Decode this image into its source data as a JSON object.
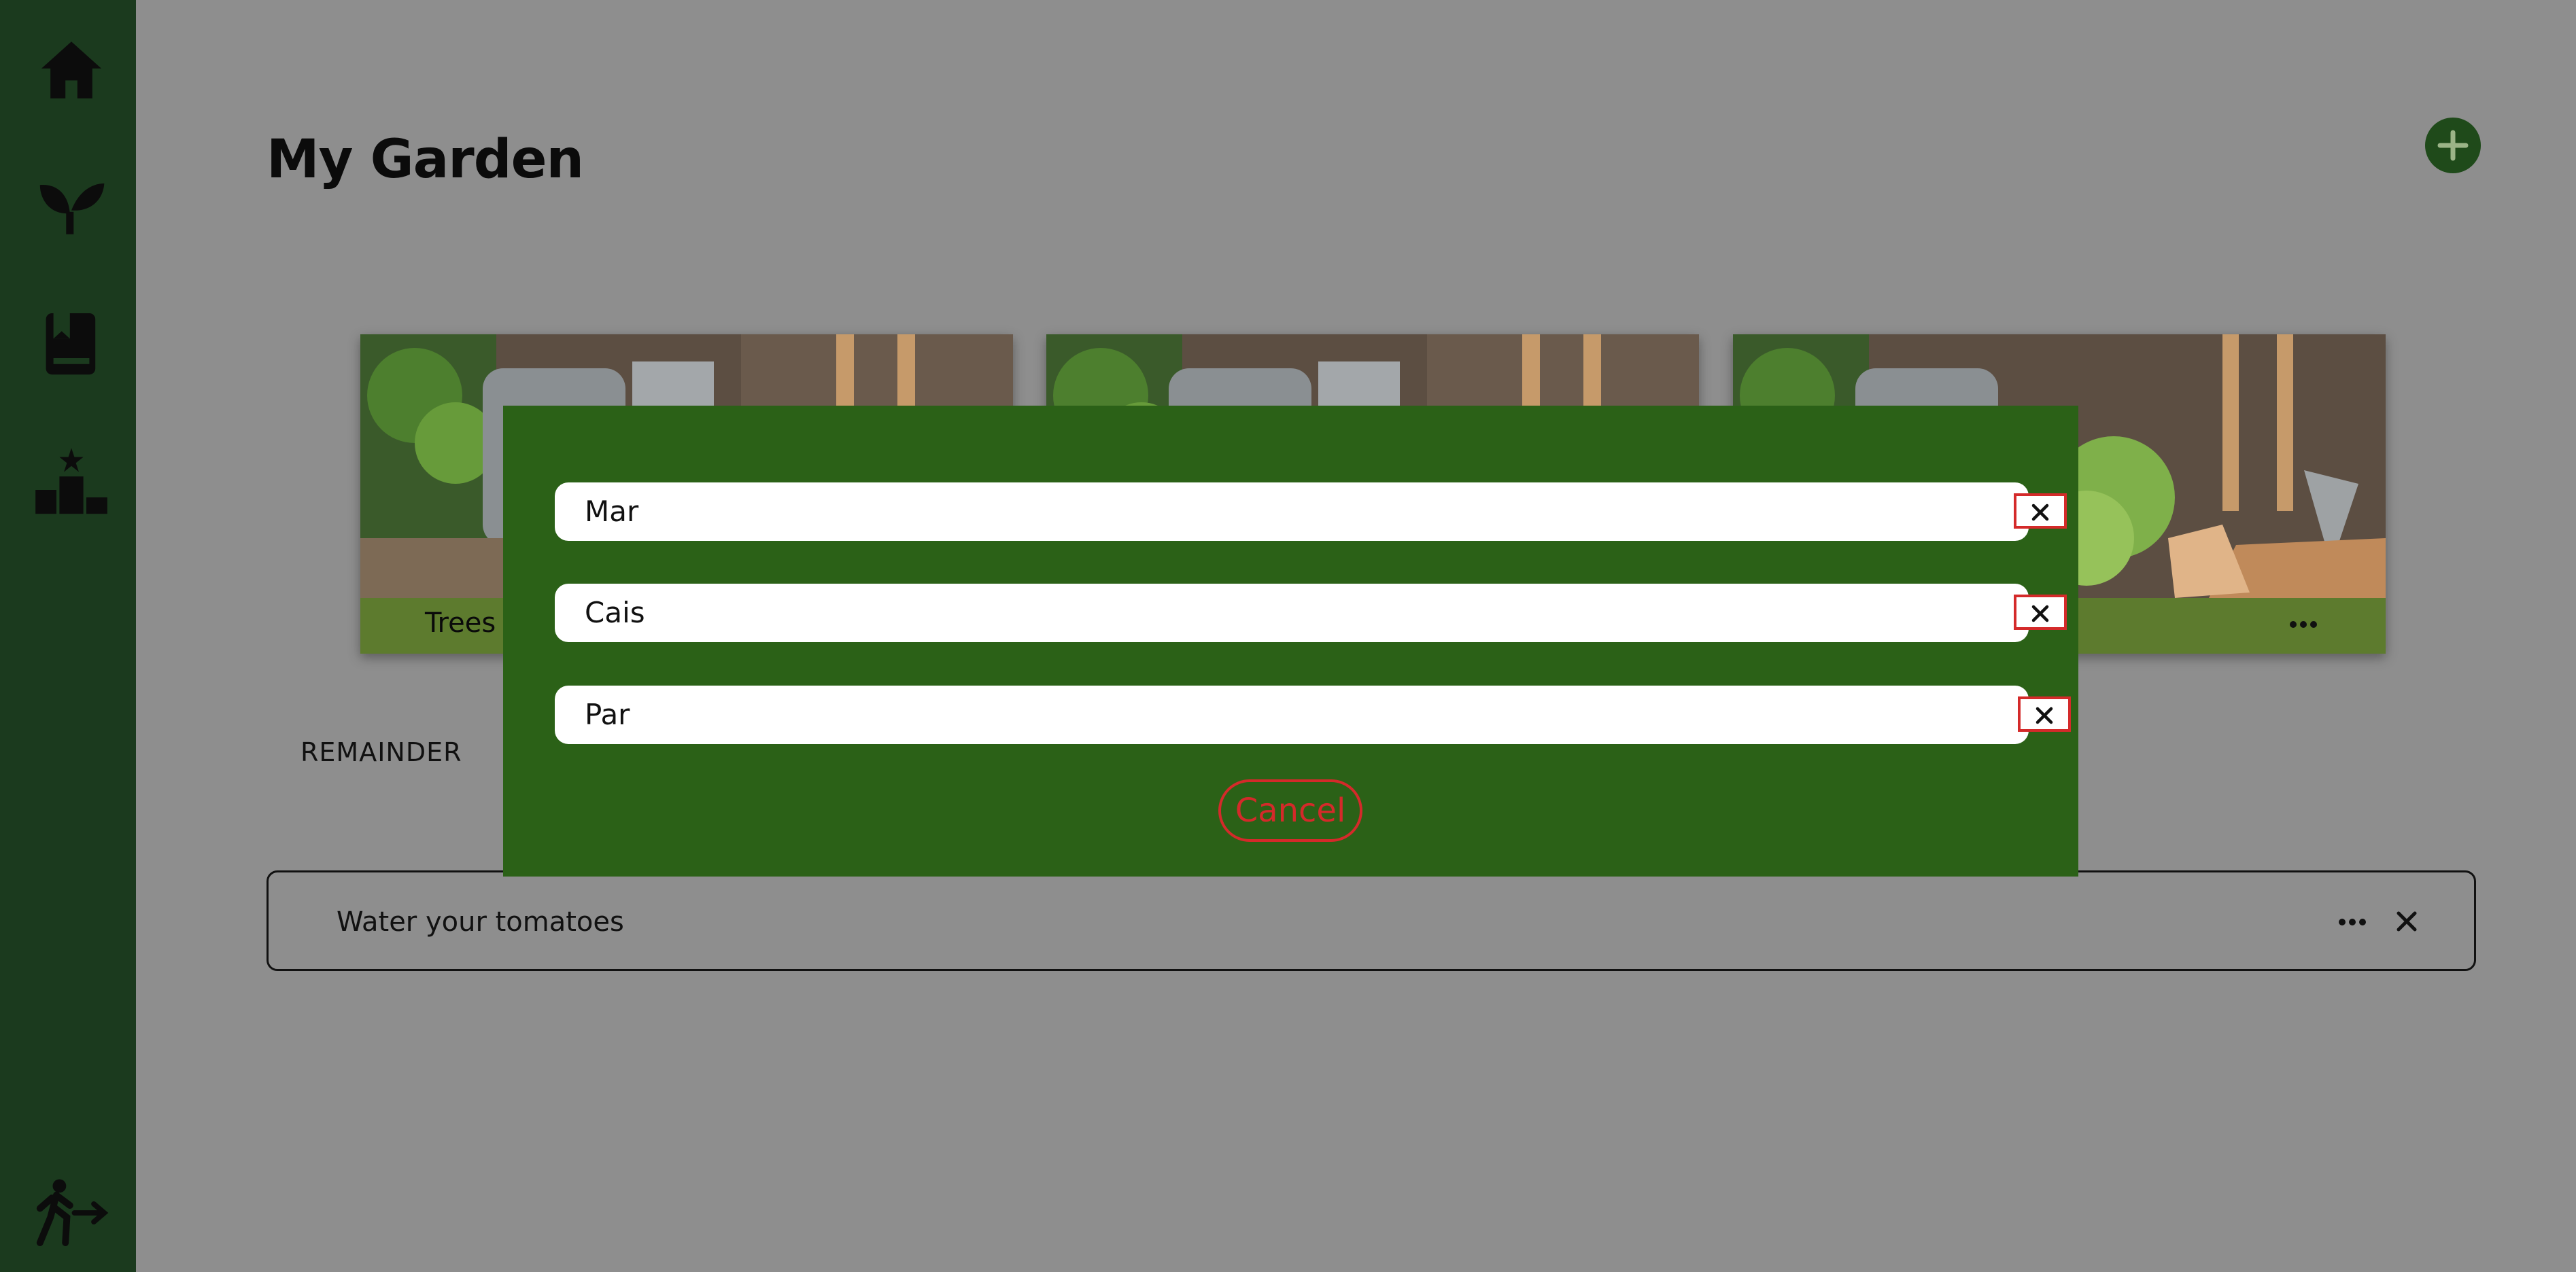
{
  "sidebar": {
    "items": [
      {
        "icon": "home-icon"
      },
      {
        "icon": "plant-icon"
      },
      {
        "icon": "book-icon"
      },
      {
        "icon": "leaderboard-icon"
      }
    ],
    "logout_icon": "logout-icon",
    "color": "#1b3a1e"
  },
  "page": {
    "title": "My Garden",
    "add_icon": "plus-icon"
  },
  "cards": [
    {
      "label": "Trees"
    },
    {
      "label": ""
    },
    {
      "label": ""
    }
  ],
  "remainder": {
    "title": "REMAINDER",
    "items": [
      {
        "text": "Water your tomatoes"
      }
    ]
  },
  "modal": {
    "fields": [
      {
        "value": "Mar"
      },
      {
        "value": "Cais"
      },
      {
        "value": "Par"
      }
    ],
    "cancel_label": "Cancel",
    "background": "#2b6117",
    "accent": "#d42a2a"
  }
}
